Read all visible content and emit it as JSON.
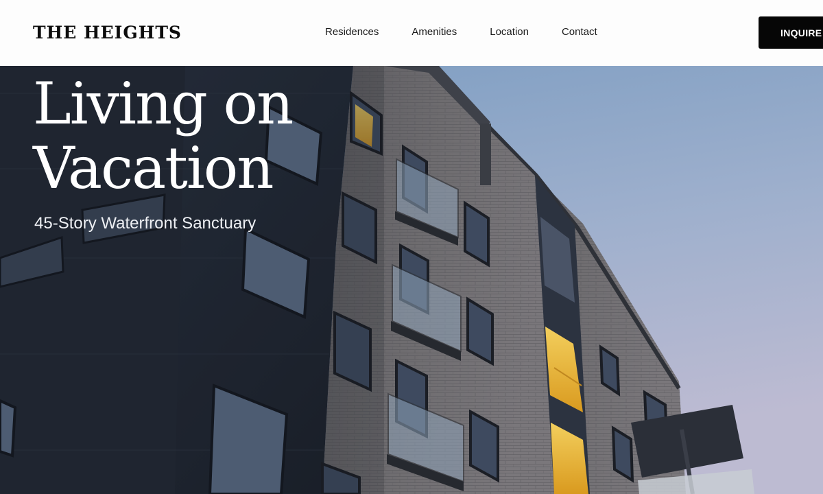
{
  "brand": {
    "name": "THE HEIGHTS"
  },
  "nav": {
    "items": [
      "Residences",
      "Amenities",
      "Location",
      "Contact"
    ]
  },
  "cta": {
    "label": "INQUIRE"
  },
  "hero": {
    "headline": "Living on Vacation",
    "subheadline": "45-Story Waterfront Sanctuary",
    "image": "apartment-building-photo"
  },
  "colors": {
    "header_bg": "#fdfdfd",
    "cta_bg": "#060606",
    "sky_top": "#7f9fc2",
    "sky_bottom": "#b4b8d0",
    "dark_facade": "#262c38",
    "brick_facade": "#68676a",
    "window_glow": "#e8b437"
  }
}
